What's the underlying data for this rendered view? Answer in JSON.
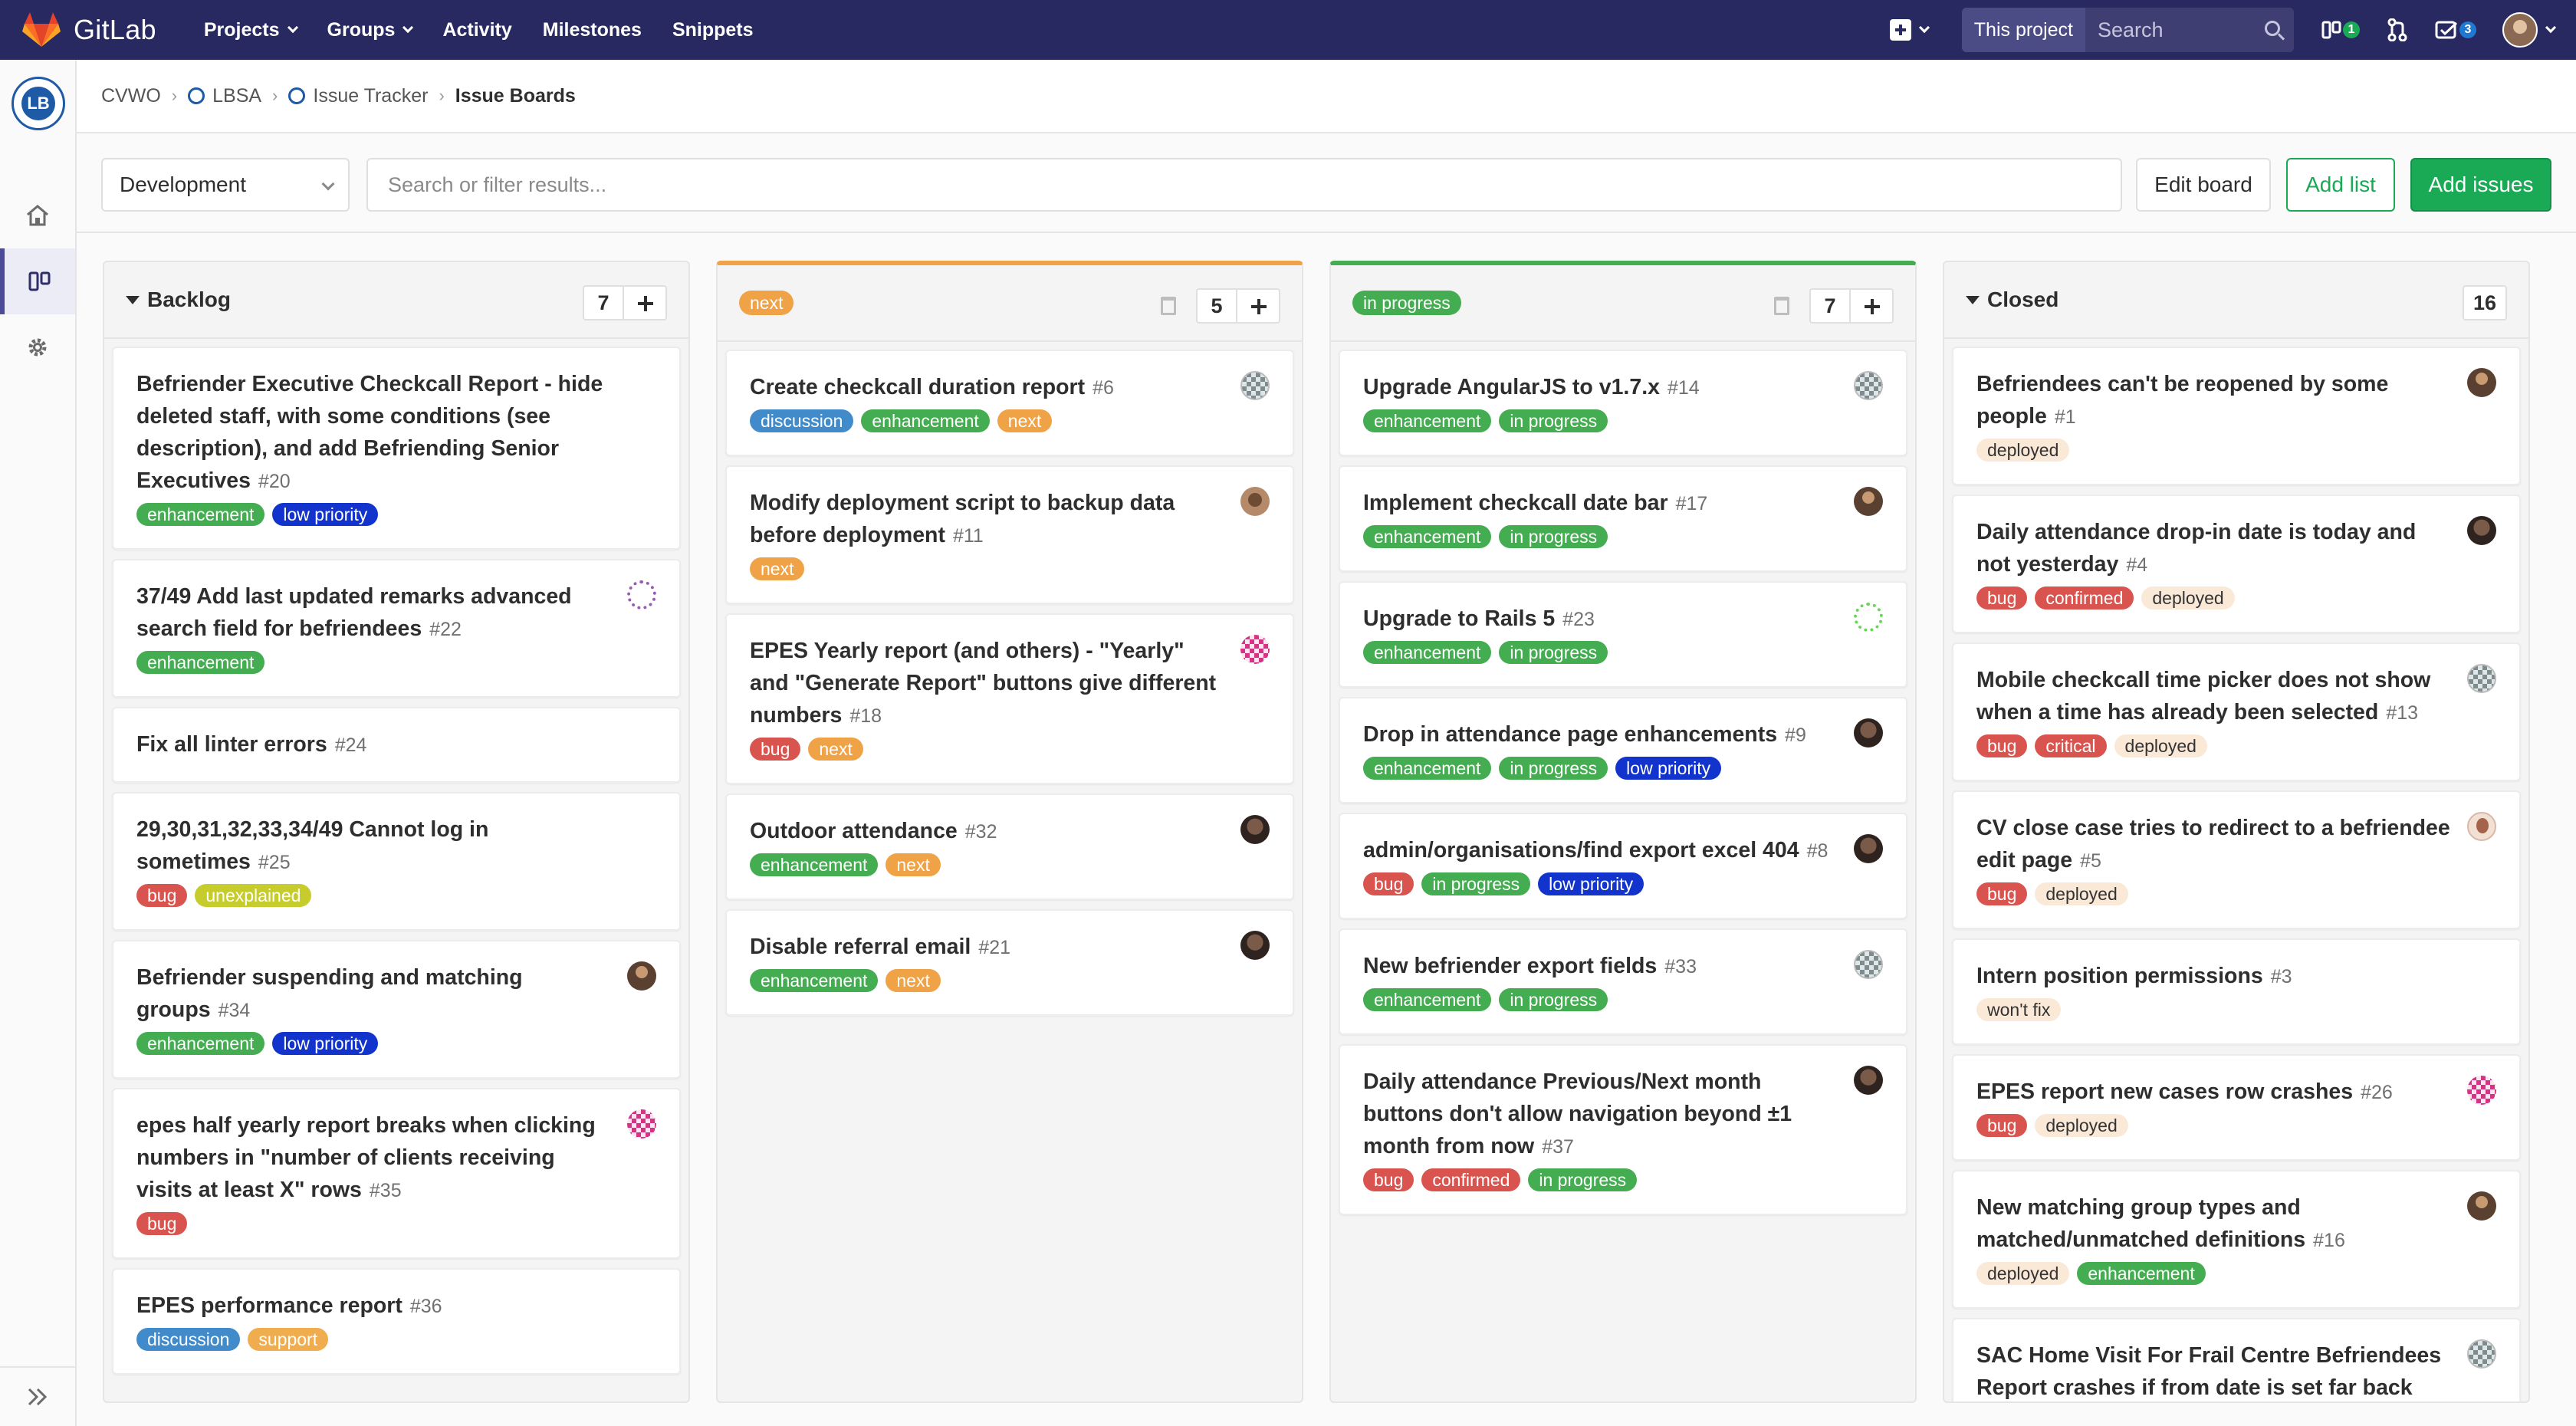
{
  "navbar": {
    "brand": "GitLab",
    "links": [
      {
        "label": "Projects",
        "caret": true
      },
      {
        "label": "Groups",
        "caret": true
      },
      {
        "label": "Activity",
        "caret": false
      },
      {
        "label": "Milestones",
        "caret": false
      },
      {
        "label": "Snippets",
        "caret": false
      }
    ],
    "search_scope": "This project",
    "search_placeholder": "Search",
    "issues_count": "1",
    "todos_count": "3",
    "colors": {
      "bg": "#292961",
      "issues_badge": "#1aaa55",
      "todos_badge": "#1f78d1"
    }
  },
  "breadcrumb": {
    "items": [
      {
        "label": "CVWO",
        "icon": false
      },
      {
        "label": "LBSA",
        "icon": true
      },
      {
        "label": "Issue Tracker",
        "icon": true
      },
      {
        "label": "Issue Boards",
        "icon": false,
        "current": true
      }
    ]
  },
  "sidebar": {
    "logo_text": "LB",
    "items": [
      {
        "icon": "home-icon",
        "active": false
      },
      {
        "icon": "boards-icon",
        "active": true
      },
      {
        "icon": "gear-icon",
        "active": false
      }
    ],
    "collapse_icon": "double-chevron-right-icon"
  },
  "filterbar": {
    "board_name": "Development",
    "filter_placeholder": "Search or filter results...",
    "edit_board": "Edit board",
    "add_list": "Add list",
    "add_issues": "Add issues"
  },
  "label_colors": {
    "enhancement": "#44ad51",
    "low priority": "#1234cc",
    "bug": "#d9534f",
    "unexplained": "#c6cc2b",
    "discussion": "#428bca",
    "support": "#f0ad4e",
    "next": "#f0a246",
    "in progress": "#44ad51",
    "confirmed": "#d9534f",
    "critical": "#d9534f",
    "deployed": "#fbe9d8",
    "won't fix": "#fbe9d8"
  },
  "label_text_dark": [
    "deployed",
    "won't fix"
  ],
  "lists": [
    {
      "kind": "backlog",
      "title": "Backlog",
      "count": "7",
      "has_add": true,
      "has_trash": false,
      "issues": [
        {
          "title": "Befriender Executive Checkcall Report - hide deleted staff, with some conditions (see description), and add Befriending Senior Executives",
          "number": "#20",
          "labels": [
            "enhancement",
            "low priority"
          ],
          "avatar": ""
        },
        {
          "title": "37/49 Add last updated remarks advanced search field for befriendees",
          "number": "#22",
          "labels": [
            "enhancement"
          ],
          "avatar": "purple"
        },
        {
          "title": "Fix all linter errors",
          "number": "#24",
          "labels": [],
          "avatar": ""
        },
        {
          "title": "29,30,31,32,33,34/49 Cannot log in sometimes",
          "number": "#25",
          "labels": [
            "bug",
            "unexplained"
          ],
          "avatar": ""
        },
        {
          "title": "Befriender suspending and matching groups",
          "number": "#34",
          "labels": [
            "enhancement",
            "low priority"
          ],
          "avatar": "brown"
        },
        {
          "title": "epes half yearly report breaks when clicking numbers in \"number of clients receiving visits at least X\" rows",
          "number": "#35",
          "labels": [
            "bug"
          ],
          "avatar": "pink"
        },
        {
          "title": "EPES performance report",
          "number": "#36",
          "labels": [
            "discussion",
            "support"
          ],
          "avatar": ""
        }
      ]
    },
    {
      "kind": "label",
      "title": "next",
      "title_color": "#f0a246",
      "count": "5",
      "has_add": true,
      "has_trash": true,
      "issues": [
        {
          "title": "Create checkcall duration report",
          "number": "#6",
          "labels": [
            "discussion",
            "enhancement",
            "next"
          ],
          "avatar": "grey"
        },
        {
          "title": "Modify deployment script to backup data before deployment",
          "number": "#11",
          "labels": [
            "next"
          ],
          "avatar": "face"
        },
        {
          "title": "EPES Yearly report (and others) - \"Yearly\" and \"Generate Report\" buttons give different numbers",
          "number": "#18",
          "labels": [
            "bug",
            "next"
          ],
          "avatar": "pink"
        },
        {
          "title": "Outdoor attendance",
          "number": "#32",
          "labels": [
            "enhancement",
            "next"
          ],
          "avatar": "dark"
        },
        {
          "title": "Disable referral email",
          "number": "#21",
          "labels": [
            "enhancement",
            "next"
          ],
          "avatar": "dark"
        }
      ]
    },
    {
      "kind": "label",
      "title": "in progress",
      "title_color": "#44ad51",
      "count": "7",
      "has_add": true,
      "has_trash": true,
      "issues": [
        {
          "title": "Upgrade AngularJS to v1.7.x",
          "number": "#14",
          "labels": [
            "enhancement",
            "in progress"
          ],
          "avatar": "grey"
        },
        {
          "title": "Implement checkcall date bar",
          "number": "#17",
          "labels": [
            "enhancement",
            "in progress"
          ],
          "avatar": "brown"
        },
        {
          "title": "Upgrade to Rails 5",
          "number": "#23",
          "labels": [
            "enhancement",
            "in progress"
          ],
          "avatar": "green"
        },
        {
          "title": "Drop in attendance page enhancements",
          "number": "#9",
          "labels": [
            "enhancement",
            "in progress",
            "low priority"
          ],
          "avatar": "dark"
        },
        {
          "title": "admin/organisations/find export excel 404",
          "number": "#8",
          "labels": [
            "bug",
            "in progress",
            "low priority"
          ],
          "avatar": "dark"
        },
        {
          "title": "New befriender export fields",
          "number": "#33",
          "labels": [
            "enhancement",
            "in progress"
          ],
          "avatar": "grey"
        },
        {
          "title": "Daily attendance Previous/Next month buttons don't allow navigation beyond ±1 month from now",
          "number": "#37",
          "labels": [
            "bug",
            "confirmed",
            "in progress"
          ],
          "avatar": "dark"
        }
      ]
    },
    {
      "kind": "closed",
      "title": "Closed",
      "count": "16",
      "has_add": false,
      "has_trash": false,
      "issues": [
        {
          "title": "Befriendees can't be reopened by some people",
          "number": "#1",
          "labels": [
            "deployed"
          ],
          "avatar": "brown"
        },
        {
          "title": "Daily attendance drop-in date is today and not yesterday",
          "number": "#4",
          "labels": [
            "bug",
            "confirmed",
            "deployed"
          ],
          "avatar": "dark"
        },
        {
          "title": "Mobile checkcall time picker does not show when a time has already been selected",
          "number": "#13",
          "labels": [
            "bug",
            "critical",
            "deployed"
          ],
          "avatar": "grey"
        },
        {
          "title": "CV close case tries to redirect to a befriendee edit page",
          "number": "#5",
          "labels": [
            "bug",
            "deployed"
          ],
          "avatar": "beige"
        },
        {
          "title": "Intern position permissions",
          "number": "#3",
          "labels": [
            "won't fix"
          ],
          "avatar": ""
        },
        {
          "title": "EPES report new cases row crashes",
          "number": "#26",
          "labels": [
            "bug",
            "deployed"
          ],
          "avatar": "pink"
        },
        {
          "title": "New matching group types and matched/unmatched definitions",
          "number": "#16",
          "labels": [
            "deployed",
            "enhancement"
          ],
          "avatar": "brown"
        },
        {
          "title": "SAC Home Visit For Frail Centre Befriendees Report crashes if from date is set far back",
          "number": "",
          "labels": [],
          "avatar": "grey"
        }
      ]
    }
  ]
}
